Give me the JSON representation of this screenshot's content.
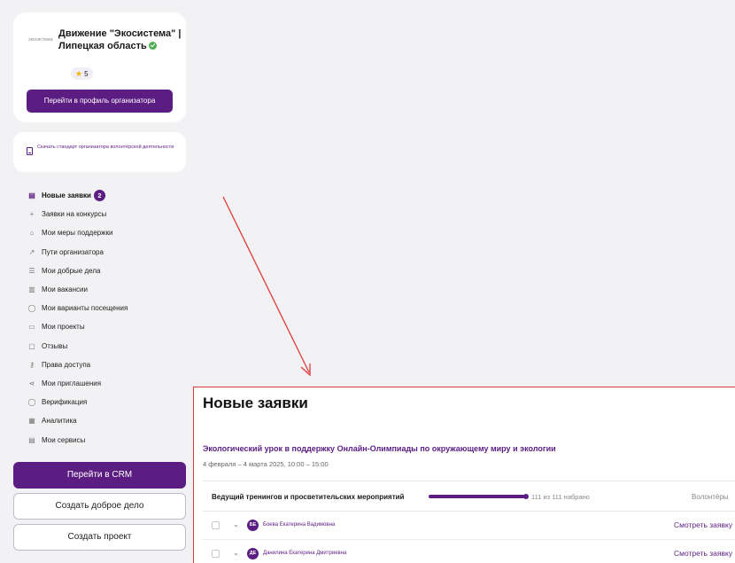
{
  "organizer": {
    "logo_text": "экосистема",
    "name": "Движение \"Экосистема\" | Липецкая область",
    "rating": "5",
    "profile_button": "Перейти в профиль организатора"
  },
  "download": {
    "label": "Скачать стандарт организатора волонтёрской деятельности"
  },
  "nav": {
    "items": [
      {
        "label": "Новые заявки",
        "icon": "requests-icon",
        "badge": "2"
      },
      {
        "label": "Заявки на конкурсы",
        "icon": "plus-icon"
      },
      {
        "label": "Мои меры поддержки",
        "icon": "support-icon"
      },
      {
        "label": "Пути организатора",
        "icon": "path-icon"
      },
      {
        "label": "Мои добрые дела",
        "icon": "list-icon"
      },
      {
        "label": "Мои вакансии",
        "icon": "vacancy-icon"
      },
      {
        "label": "Мои варианты посещения",
        "icon": "visit-icon"
      },
      {
        "label": "Мои проекты",
        "icon": "projects-icon"
      },
      {
        "label": "Отзывы",
        "icon": "reviews-icon"
      },
      {
        "label": "Права доступа",
        "icon": "key-icon"
      },
      {
        "label": "Мои приглашения",
        "icon": "share-icon"
      },
      {
        "label": "Верификация",
        "icon": "verify-icon"
      },
      {
        "label": "Аналитика",
        "icon": "analytics-icon"
      },
      {
        "label": "Мои сервисы",
        "icon": "services-icon"
      }
    ]
  },
  "buttons": {
    "crm": "Перейти в CRM",
    "create_good_deed": "Создать доброе дело",
    "create_project": "Создать проект"
  },
  "panel": {
    "title": "Новые заявки",
    "event_title": "Экологический урок в поддержку Онлайн-Олимпиады по окружающему миру и экологии",
    "event_date": "4 февраля – 4 марта 2025, 10:00 – 15:00",
    "role": "Ведущий тренингов и просветительских мероприятий",
    "count": "111 из 111 набрано",
    "progress_fraction": 1.0,
    "volunteers_col": "Волонтёры",
    "rows": [
      {
        "initials": "БЕ",
        "name": "Боева Екатерина Вадимовна",
        "action": "Смотреть заявку"
      },
      {
        "initials": "ДЕ",
        "name": "Данилина Екатерина Дмитриевна",
        "action": "Смотреть заявку"
      }
    ]
  },
  "colors": {
    "accent": "#5b1d82",
    "highlight_border": "#e03a3a",
    "background": "#f2f2f4"
  }
}
